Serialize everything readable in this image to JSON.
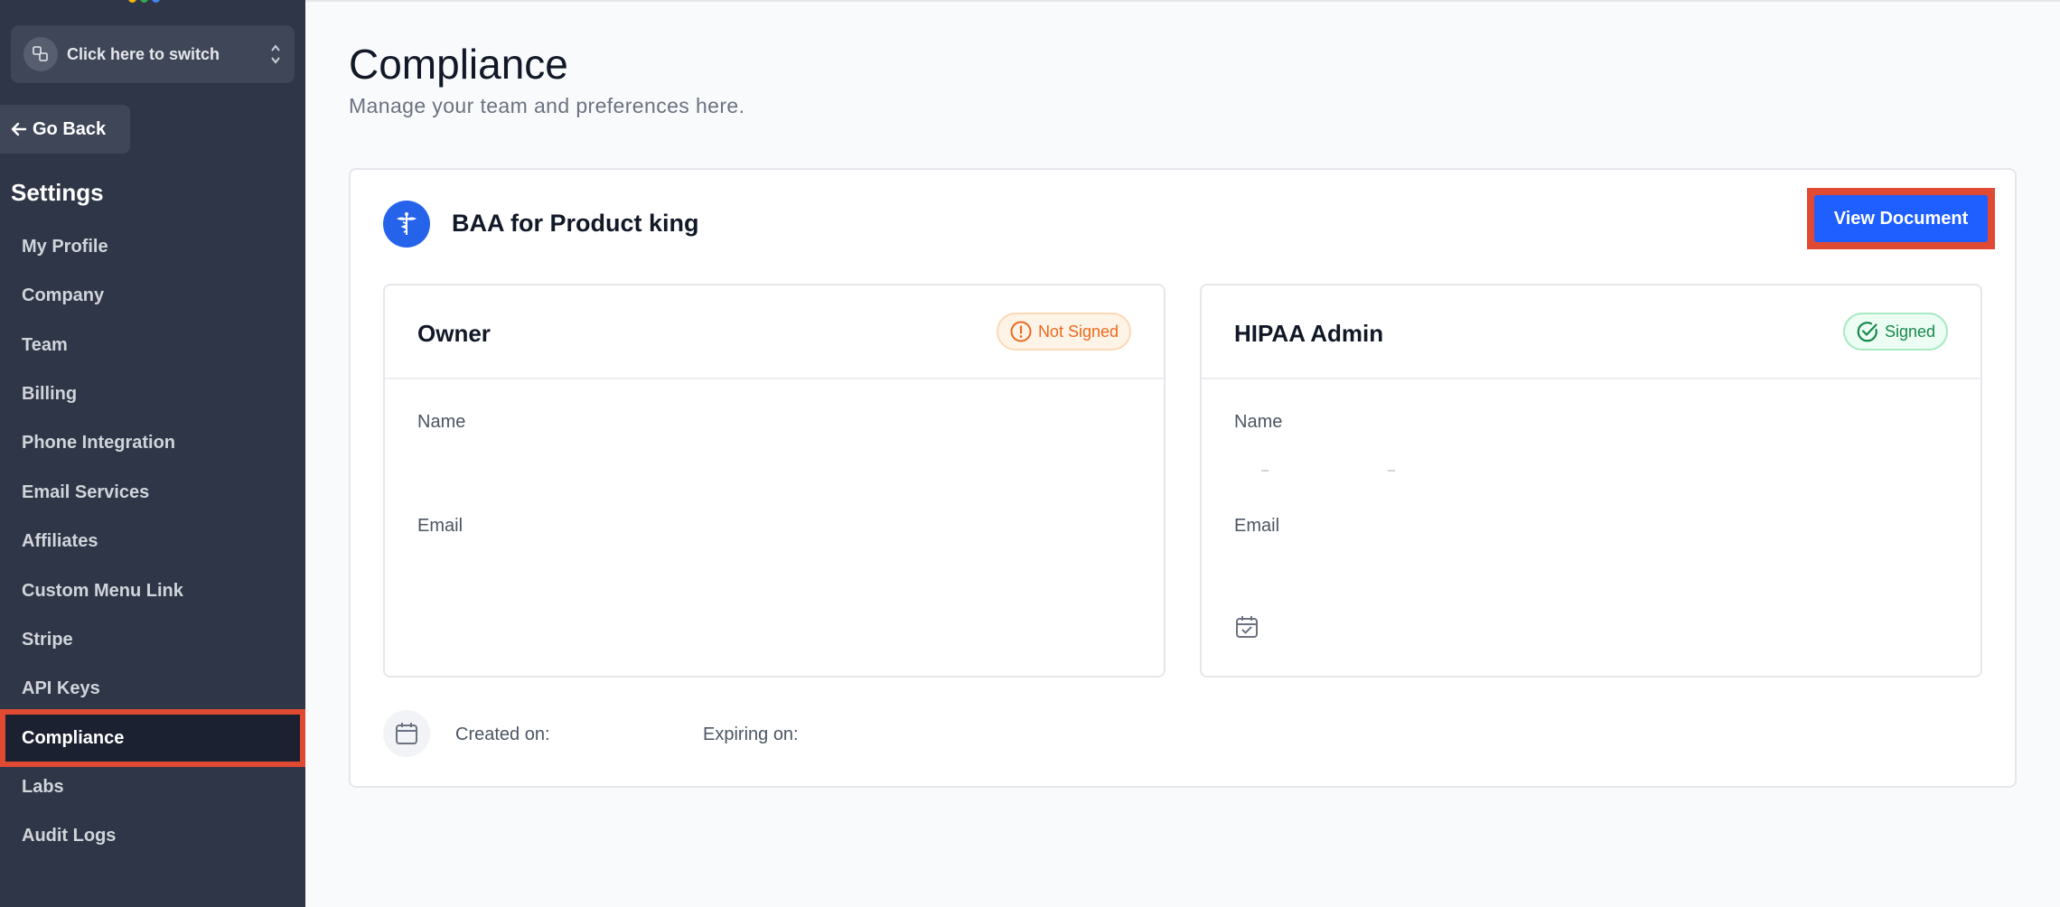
{
  "sidebar": {
    "switcher_label": "Click here to switch",
    "go_back_label": "Go Back",
    "settings_title": "Settings",
    "items": [
      {
        "label": "My Profile"
      },
      {
        "label": "Company"
      },
      {
        "label": "Team"
      },
      {
        "label": "Billing"
      },
      {
        "label": "Phone Integration"
      },
      {
        "label": "Email Services"
      },
      {
        "label": "Affiliates"
      },
      {
        "label": "Custom Menu Link"
      },
      {
        "label": "Stripe"
      },
      {
        "label": "API Keys"
      },
      {
        "label": "Compliance",
        "active": true
      },
      {
        "label": "Labs"
      },
      {
        "label": "Audit Logs"
      }
    ]
  },
  "main": {
    "title": "Compliance",
    "subtitle": "Manage your team and preferences here.",
    "card": {
      "title": "BAA for Product king",
      "view_document_label": "View Document",
      "owner": {
        "title": "Owner",
        "status": "Not Signed",
        "name_label": "Name",
        "email_label": "Email"
      },
      "admin": {
        "title": "HIPAA Admin",
        "status": "Signed",
        "name_label": "Name",
        "email_label": "Email"
      },
      "created_label": "Created on:",
      "expiring_label": "Expiring on:"
    }
  },
  "colors": {
    "sidebar_bg": "#2e3647",
    "accent_blue": "#1f5eff",
    "highlight_red": "#e04a32",
    "warning_orange": "#ea6a1f",
    "success_green": "#16894a"
  }
}
